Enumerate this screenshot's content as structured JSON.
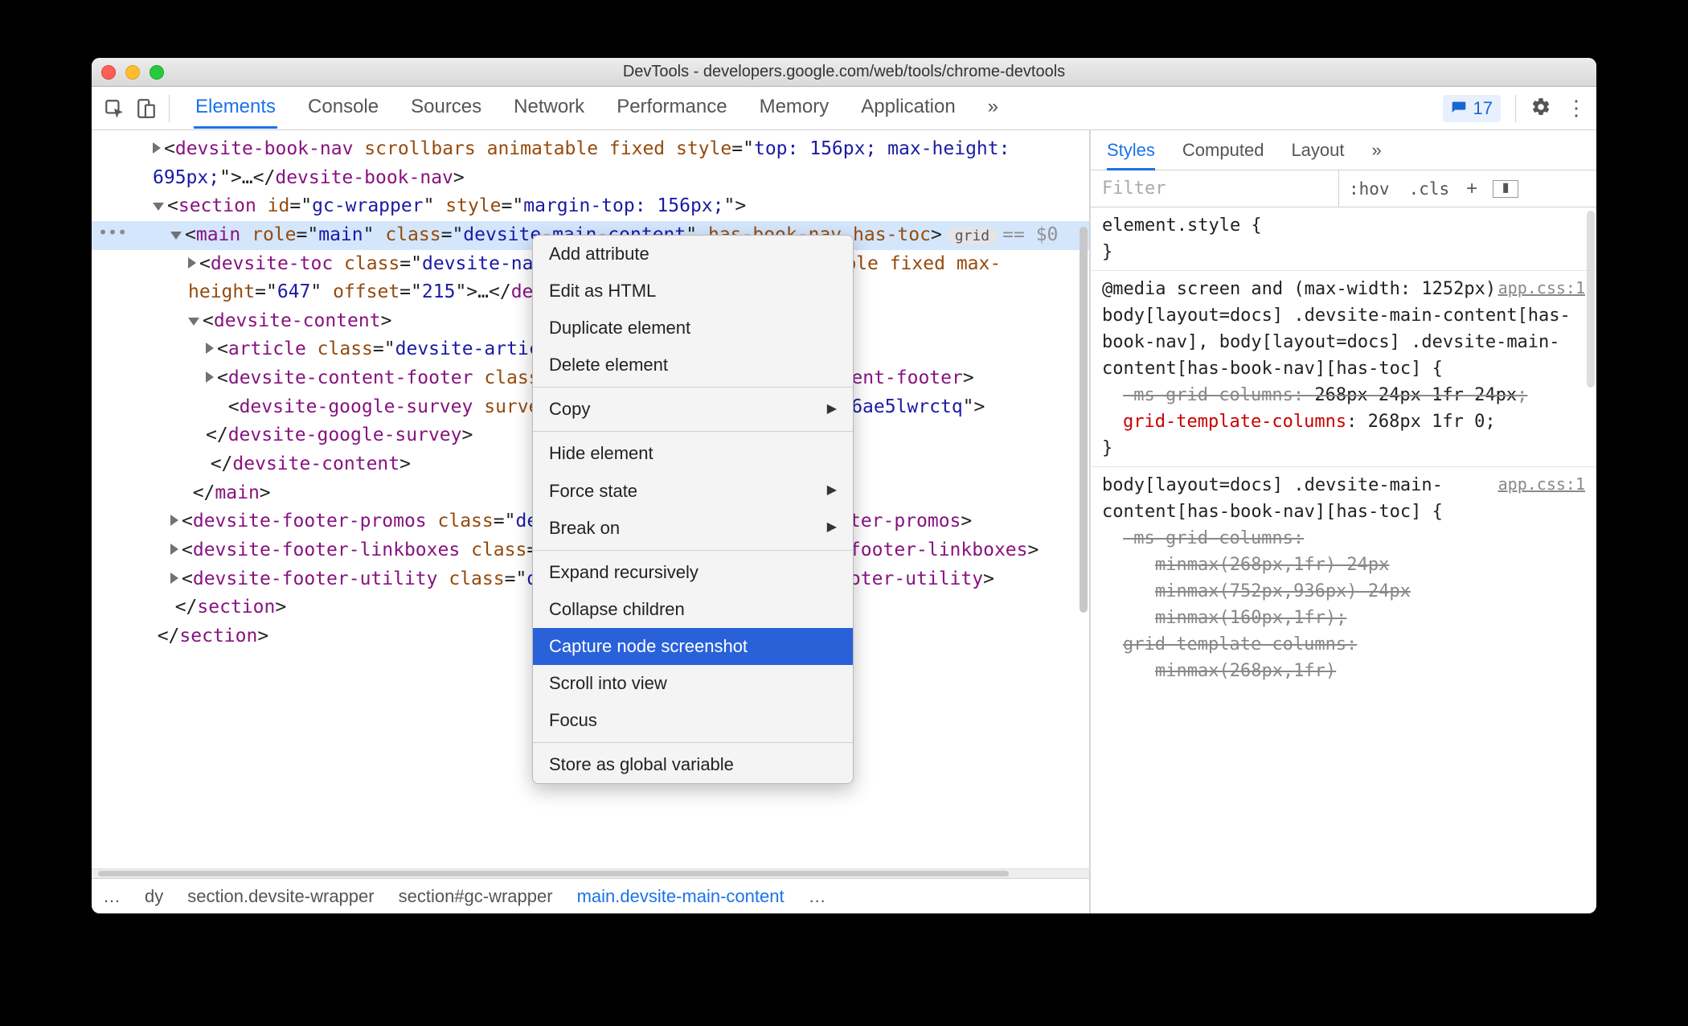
{
  "window_title": "DevTools - developers.google.com/web/tools/chrome-devtools",
  "issues_count": "17",
  "tabs": [
    "Elements",
    "Console",
    "Sources",
    "Network",
    "Performance",
    "Memory",
    "Application"
  ],
  "rtabs": [
    "Styles",
    "Computed",
    "Layout"
  ],
  "filter_placeholder": "Filter",
  "hov": ":hov",
  "cls": ".cls",
  "dom": {
    "l0a": "<devsite-book-nav scrollbars animatable fixed style=\"top: 156px; max-height: 695px;\">…</devsite-book-nav>",
    "l1": "<section id=\"gc-wrapper\" style=\"margin-top: 156px;\">",
    "l2": "<main role=\"main\" class=\"devsite-main-content\" has-book-nav has-toc>",
    "badge": "grid",
    "eq": "== $0",
    "l3": "<devsite-toc class=\"devsite-nav\" depth=\"2\" scrollbars visible fixed max-height=\"647\" offset=\"215\">…</devsite-toc>",
    "l4": "<devsite-content>",
    "l5": "<article class=\"devsite-article\">…</article>",
    "l6": "<devsite-content-footer class=\"nocontent\">…</devsite-content-footer>",
    "l7": "<devsite-google-survey survey-id=\"fko7ke6vj5ifxusvvmr4pp6ae5lwrctq\"></devsite-google-survey>",
    "l8": "</devsite-content>",
    "l9": "</main>",
    "l10": "<devsite-footer-promos class=\"devsite-footer\">…</devsite-footer-promos>",
    "l11": "<devsite-footer-linkboxes class=\"devsite-footer\">…</devsite-footer-linkboxes>",
    "l12": "<devsite-footer-utility class=\"devsite-footer\">…</devsite-footer-utility>",
    "l13": "</section>",
    "l14": "</section>"
  },
  "ctx": {
    "add": "Add attribute",
    "edit": "Edit as HTML",
    "dup": "Duplicate element",
    "del": "Delete element",
    "copy": "Copy",
    "hide": "Hide element",
    "force": "Force state",
    "break": "Break on",
    "expand": "Expand recursively",
    "collapse": "Collapse children",
    "capture": "Capture node screenshot",
    "scroll": "Scroll into view",
    "focus": "Focus",
    "store": "Store as global variable"
  },
  "crumbs": [
    "dy",
    "section.devsite-wrapper",
    "section#gc-wrapper",
    "main.devsite-main-content"
  ],
  "styles": {
    "r1_sel": "element.style {",
    "r1_close": "}",
    "r2_media": "@media screen and (max-width: 1252px)",
    "r2_src": "app.css:1",
    "r2_sel": "body[layout=docs] .devsite-main-content[has-book-nav], body[layout=docs] .devsite-main-content[has-book-nav][has-toc] {",
    "r2_p1": "-ms-grid-columns: 268px 24px 1fr 24px;",
    "r2_p2a": "grid-template-columns",
    "r2_p2b": ": 268px 1fr 0;",
    "r2_close": "}",
    "r3_src": "app.css:1",
    "r3_sel": "body[layout=docs] .devsite-main-content[has-book-nav][has-toc] {",
    "r3_p1": "-ms-grid-columns:",
    "r3_p2": "minmax(268px,1fr) 24px",
    "r3_p3": "minmax(752px,936px) 24px",
    "r3_p4": "minmax(160px,1fr);",
    "r3_p5": "grid-template-columns:",
    "r3_p6": "minmax(268px,1fr)"
  }
}
